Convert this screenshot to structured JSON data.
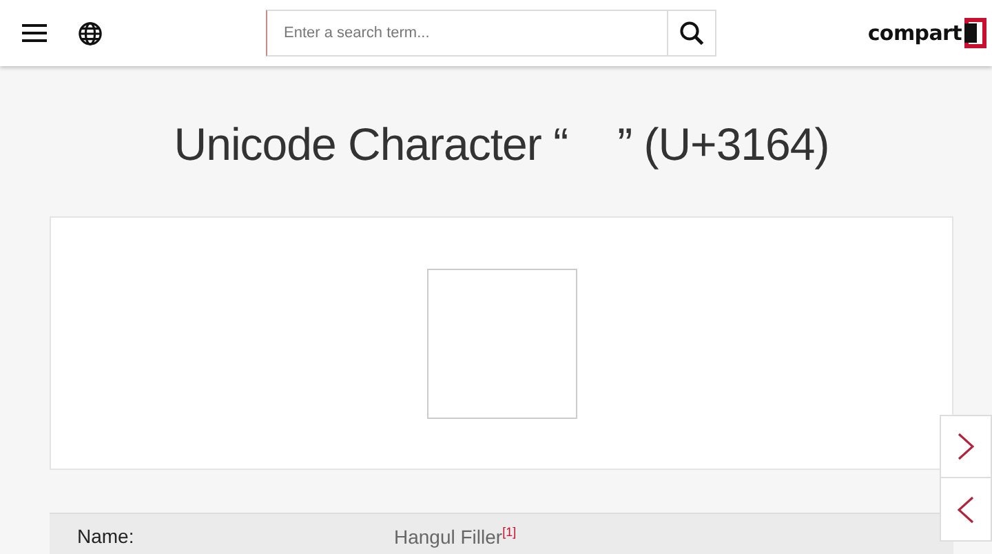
{
  "header": {
    "search": {
      "placeholder": "Enter a search term..."
    },
    "logo": "compart"
  },
  "title": {
    "before": "Unicode Character “",
    "after": "” (U+3164)"
  },
  "properties": [
    {
      "label": "Name:",
      "value": "Hangul Filler$^{[1]}$"
    }
  ]
}
